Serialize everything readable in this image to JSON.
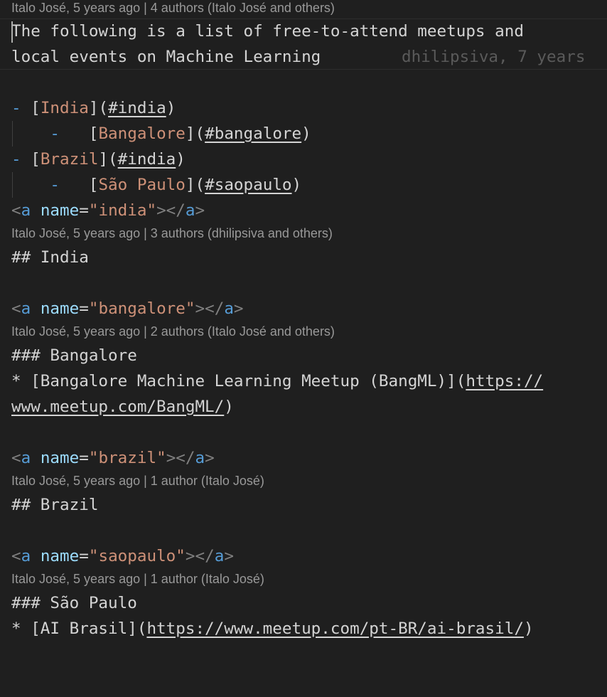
{
  "lens": {
    "l1": "Italo José, 5 years ago | 4 authors (Italo José and others)",
    "l2": "Italo José, 5 years ago | 3 authors (dhilipsiva and others)",
    "l3": "Italo José, 5 years ago | 2 authors (Italo José and others)",
    "l4": "Italo José, 5 years ago | 1 author (Italo José)",
    "l5": "Italo José, 5 years ago | 1 author (Italo José)"
  },
  "intro": {
    "line1": "The following is a list of free-to-attend meetups and",
    "line2": "local events on Machine Learning",
    "blame": "dhilipsiva, 7 years"
  },
  "toc": [
    {
      "dash": "-",
      "text": "India",
      "anchor": "#india",
      "indent": false
    },
    {
      "dash": "-",
      "text": "Bangalore",
      "anchor": "#bangalore",
      "indent": true
    },
    {
      "dash": "-",
      "text": "Brazil",
      "anchor": "#india",
      "indent": false
    },
    {
      "dash": "-",
      "text": "São Paulo",
      "anchor": "#saopaulo",
      "indent": true
    }
  ],
  "anchors": {
    "a1": {
      "open": "<",
      "tag": "a",
      "attr": "name",
      "eq": "=",
      "value": "\"india\"",
      "close1": "></",
      "close2": ">"
    },
    "a2": {
      "open": "<",
      "tag": "a",
      "attr": "name",
      "eq": "=",
      "value": "\"bangalore\"",
      "close1": "></",
      "close2": ">"
    },
    "a3": {
      "open": "<",
      "tag": "a",
      "attr": "name",
      "eq": "=",
      "value": "\"brazil\"",
      "close1": "></",
      "close2": ">"
    },
    "a4": {
      "open": "<",
      "tag": "a",
      "attr": "name",
      "eq": "=",
      "value": "\"saopaulo\"",
      "close1": "></",
      "close2": ">"
    }
  },
  "headings": {
    "india": "## India",
    "bangalore": "### Bangalore",
    "brazil": "## Brazil",
    "saopaulo": "### São Paulo"
  },
  "bullets": {
    "bang_prefix": "* [Bangalore Machine Learning Meetup (BangML)](",
    "bang_url1": "https://",
    "bang_url2": "www.meetup.com/BangML/",
    "bang_suffix": ")",
    "ai_prefix": "* [AI Brasil](",
    "ai_url": "https://www.meetup.com/pt-BR/ai-brasil/",
    "ai_suffix": ")"
  },
  "brackets": {
    "open": "[",
    "mid": "](",
    "close": ")"
  }
}
